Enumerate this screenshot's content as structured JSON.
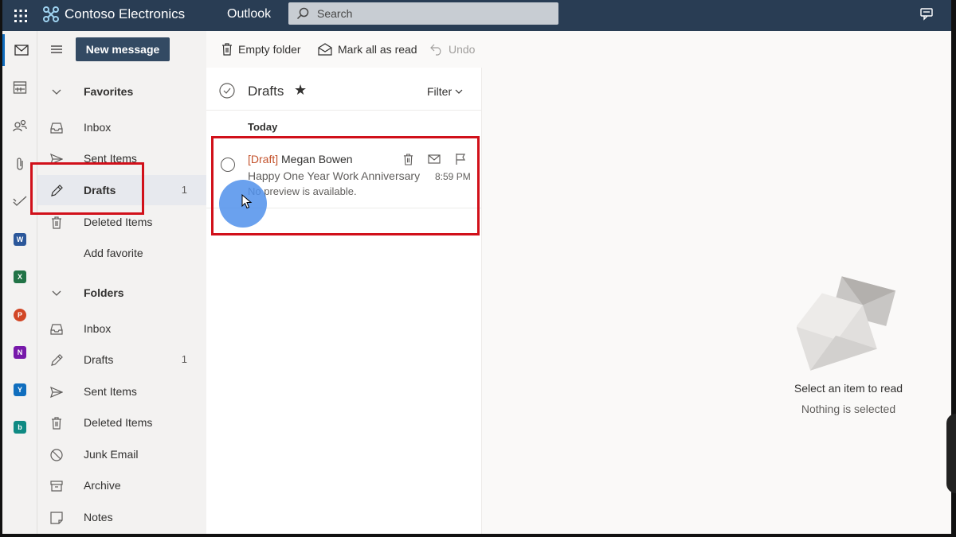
{
  "topbar": {
    "brand": "Contoso Electronics",
    "app": "Outlook",
    "search_placeholder": "Search"
  },
  "toolbar": {
    "new_message": "New message",
    "empty_folder": "Empty folder",
    "mark_all_read": "Mark all as read",
    "undo": "Undo"
  },
  "favorites": {
    "title": "Favorites",
    "items": [
      {
        "label": "Inbox",
        "count": ""
      },
      {
        "label": "Sent Items",
        "count": ""
      },
      {
        "label": "Drafts",
        "count": "1"
      },
      {
        "label": "Deleted Items",
        "count": ""
      },
      {
        "label": "Add favorite",
        "count": ""
      }
    ]
  },
  "folders": {
    "title": "Folders",
    "items": [
      {
        "label": "Inbox",
        "count": ""
      },
      {
        "label": "Drafts",
        "count": "1"
      },
      {
        "label": "Sent Items",
        "count": ""
      },
      {
        "label": "Deleted Items",
        "count": ""
      },
      {
        "label": "Junk Email",
        "count": ""
      },
      {
        "label": "Archive",
        "count": ""
      },
      {
        "label": "Notes",
        "count": ""
      }
    ]
  },
  "message_list": {
    "title": "Drafts",
    "filter": "Filter",
    "group": "Today",
    "messages": [
      {
        "draft_tag": "[Draft]",
        "sender": "Megan Bowen",
        "subject": "Happy One Year Work Anniversary",
        "preview": "No preview is available.",
        "time": "8:59 PM"
      }
    ]
  },
  "reading_pane": {
    "title": "Select an item to read",
    "subtitle": "Nothing is selected"
  },
  "rail_apps": [
    {
      "letter": "W",
      "color": "#2b579a"
    },
    {
      "letter": "X",
      "color": "#217346"
    },
    {
      "letter": "P",
      "color": "#d24726"
    },
    {
      "letter": "N",
      "color": "#7719aa"
    },
    {
      "letter": "Y",
      "color": "#106ebe"
    },
    {
      "letter": "b",
      "color": "#0f8a83"
    }
  ],
  "colors": {
    "topbar": "#293d54",
    "new_message_button": "#334a63",
    "highlight": "#d1101a",
    "draft_tag": "#c4532d"
  }
}
